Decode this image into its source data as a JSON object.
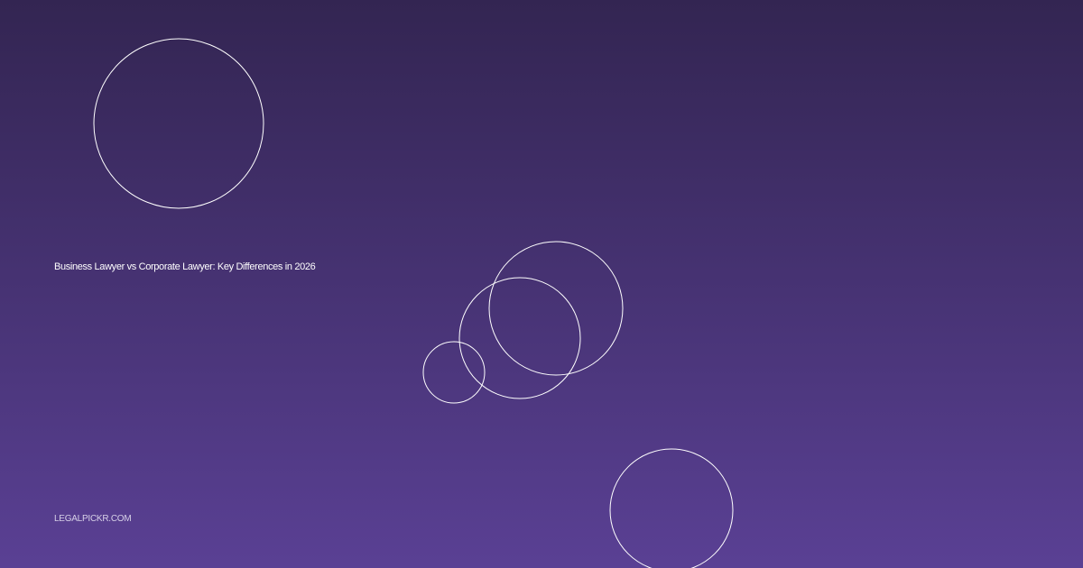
{
  "card": {
    "title": "Business Lawyer vs Corporate Lawyer: Key Differences in 2026",
    "site": "LEGALPICKR.COM"
  },
  "colors": {
    "background_top": "#332552",
    "background_bottom": "#5a4094",
    "circle_stroke": "#ffffff",
    "title_text": "#ffffff",
    "site_text": "#d7d1e8"
  }
}
